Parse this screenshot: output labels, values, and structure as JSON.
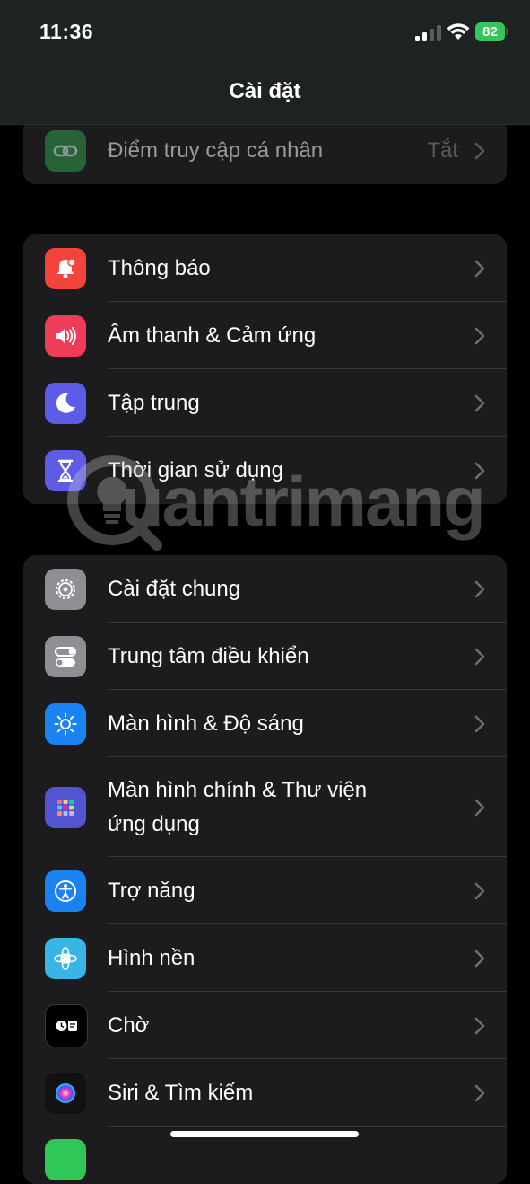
{
  "status_bar": {
    "time": "11:36",
    "battery": "82"
  },
  "header": {
    "title": "Cài đặt"
  },
  "group_top": {
    "items": [
      {
        "label": "Điểm truy cập cá nhân",
        "value": "Tắt",
        "icon": "link-icon",
        "color": "#30a14e"
      }
    ]
  },
  "group_notifications": {
    "items": [
      {
        "label": "Thông báo",
        "icon": "bell-icon",
        "color": "#f3443c"
      },
      {
        "label": "Âm thanh & Cảm ứng",
        "icon": "speaker-icon",
        "color": "#ef3c59"
      },
      {
        "label": "Tập trung",
        "icon": "moon-icon",
        "color": "#5e5ce6"
      },
      {
        "label": "Thời gian sử dụng",
        "icon": "hourglass-icon",
        "color": "#5e5ce6"
      }
    ]
  },
  "group_general": {
    "items": [
      {
        "label": "Cài đặt chung",
        "icon": "gear-icon",
        "color": "#8e8e93"
      },
      {
        "label": "Trung tâm điều khiển",
        "icon": "toggles-icon",
        "color": "#8e8e93"
      },
      {
        "label": "Màn hình & Độ sáng",
        "icon": "sun-icon",
        "color": "#1b82f2"
      },
      {
        "label": "Màn hình chính & Thư viện ứng dụng",
        "icon": "app-grid-icon",
        "color": "#5254d4"
      },
      {
        "label": "Trợ năng",
        "icon": "accessibility-icon",
        "color": "#1b82f2"
      },
      {
        "label": "Hình nền",
        "icon": "flower-icon",
        "color": "#36b5e6"
      },
      {
        "label": "Chờ",
        "icon": "standby-icon",
        "color": "#000000"
      },
      {
        "label": "Siri & Tìm kiếm",
        "icon": "siri-icon",
        "color": "#111111"
      }
    ]
  },
  "watermark": {
    "text": "uantrimang"
  }
}
